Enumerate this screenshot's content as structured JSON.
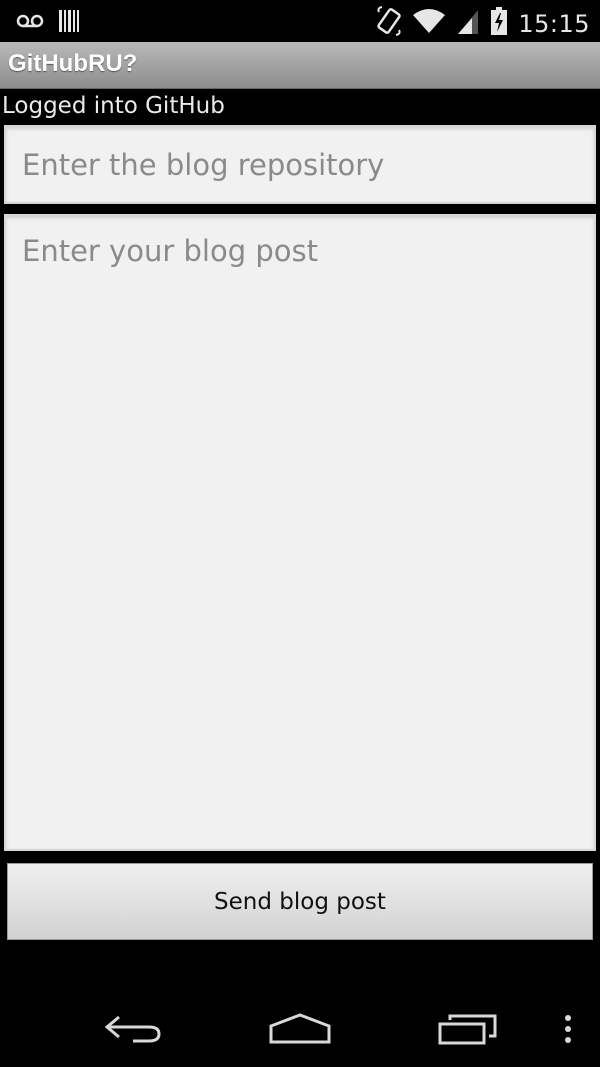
{
  "status_bar": {
    "time": "15:15",
    "icons": [
      "voicemail-icon",
      "barcode-icon",
      "rotate-icon",
      "wifi-icon",
      "signal-icon",
      "battery-charging-icon"
    ]
  },
  "action_bar": {
    "title": "GitHubRU?"
  },
  "main": {
    "login_status": "Logged into GitHub",
    "repository_input": {
      "value": "",
      "placeholder": "Enter the blog repository"
    },
    "post_input": {
      "value": "",
      "placeholder": "Enter your blog post"
    },
    "send_button_label": "Send blog post"
  },
  "nav_bar": {
    "icons": [
      "back-icon",
      "home-icon",
      "recent-apps-icon",
      "overflow-menu-icon"
    ]
  },
  "colors": {
    "action_bar_top": "#b9b9b9",
    "action_bar_bottom": "#8d8d8d",
    "field_background": "#f1f1f1",
    "background": "#000000"
  }
}
